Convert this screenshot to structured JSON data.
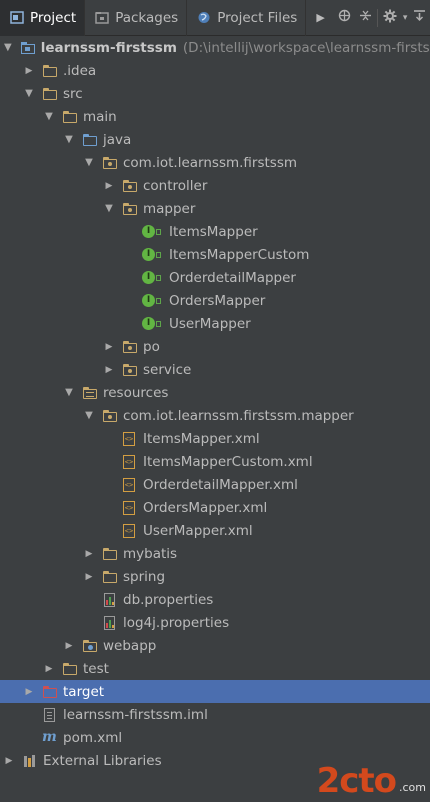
{
  "toolbar": {
    "tabs": [
      {
        "label": "Project",
        "icon": "project-icon"
      },
      {
        "label": "Packages",
        "icon": "packages-icon"
      },
      {
        "label": "Project Files",
        "icon": "project-files-icon"
      }
    ],
    "more_icon": "chevron-right-icon",
    "actions": [
      "globe-settings-icon",
      "collapse-icon",
      "gear-icon",
      "hide-icon"
    ]
  },
  "tree": [
    {
      "label": "learnssm-firstssm",
      "path": "(D:\\intellij\\workspace\\learnssm-firstssm",
      "depth": 0,
      "arrow": "down",
      "icon": "module-icon",
      "bold": true
    },
    {
      "label": ".idea",
      "depth": 1,
      "arrow": "right",
      "icon": "folder-icon"
    },
    {
      "label": "src",
      "depth": 1,
      "arrow": "down",
      "icon": "folder-icon"
    },
    {
      "label": "main",
      "depth": 2,
      "arrow": "down",
      "icon": "folder-icon"
    },
    {
      "label": "java",
      "depth": 3,
      "arrow": "down",
      "icon": "source-folder-icon"
    },
    {
      "label": "com.iot.learnssm.firstssm",
      "depth": 4,
      "arrow": "down",
      "icon": "package-icon"
    },
    {
      "label": "controller",
      "depth": 5,
      "arrow": "right",
      "icon": "package-icon"
    },
    {
      "label": "mapper",
      "depth": 5,
      "arrow": "down",
      "icon": "package-icon"
    },
    {
      "label": "ItemsMapper",
      "depth": 6,
      "arrow": "none",
      "icon": "interface-icon"
    },
    {
      "label": "ItemsMapperCustom",
      "depth": 6,
      "arrow": "none",
      "icon": "interface-icon"
    },
    {
      "label": "OrderdetailMapper",
      "depth": 6,
      "arrow": "none",
      "icon": "interface-icon"
    },
    {
      "label": "OrdersMapper",
      "depth": 6,
      "arrow": "none",
      "icon": "interface-icon"
    },
    {
      "label": "UserMapper",
      "depth": 6,
      "arrow": "none",
      "icon": "interface-icon"
    },
    {
      "label": "po",
      "depth": 5,
      "arrow": "right",
      "icon": "package-icon"
    },
    {
      "label": "service",
      "depth": 5,
      "arrow": "right",
      "icon": "package-icon"
    },
    {
      "label": "resources",
      "depth": 3,
      "arrow": "down",
      "icon": "resources-folder-icon"
    },
    {
      "label": "com.iot.learnssm.firstssm.mapper",
      "depth": 4,
      "arrow": "down",
      "icon": "package-icon"
    },
    {
      "label": "ItemsMapper.xml",
      "depth": 5,
      "arrow": "none",
      "icon": "xml-file-icon"
    },
    {
      "label": "ItemsMapperCustom.xml",
      "depth": 5,
      "arrow": "none",
      "icon": "xml-file-icon"
    },
    {
      "label": "OrderdetailMapper.xml",
      "depth": 5,
      "arrow": "none",
      "icon": "xml-file-icon"
    },
    {
      "label": "OrdersMapper.xml",
      "depth": 5,
      "arrow": "none",
      "icon": "xml-file-icon"
    },
    {
      "label": "UserMapper.xml",
      "depth": 5,
      "arrow": "none",
      "icon": "xml-file-icon"
    },
    {
      "label": "mybatis",
      "depth": 4,
      "arrow": "right",
      "icon": "folder-icon"
    },
    {
      "label": "spring",
      "depth": 4,
      "arrow": "right",
      "icon": "folder-icon"
    },
    {
      "label": "db.properties",
      "depth": 4,
      "arrow": "none",
      "icon": "properties-file-icon"
    },
    {
      "label": "log4j.properties",
      "depth": 4,
      "arrow": "none",
      "icon": "properties-file-icon"
    },
    {
      "label": "webapp",
      "depth": 3,
      "arrow": "right",
      "icon": "web-folder-icon"
    },
    {
      "label": "test",
      "depth": 2,
      "arrow": "right",
      "icon": "folder-icon"
    },
    {
      "label": "target",
      "depth": 1,
      "arrow": "right",
      "icon": "excluded-folder-icon",
      "selected": true
    },
    {
      "label": "learnssm-firstssm.iml",
      "depth": 1,
      "arrow": "none",
      "icon": "iml-file-icon"
    },
    {
      "label": "pom.xml",
      "depth": 1,
      "arrow": "none",
      "icon": "maven-icon"
    },
    {
      "label": "External Libraries",
      "depth": 0,
      "arrow": "right",
      "icon": "libraries-icon"
    }
  ],
  "watermark": {
    "main": "2cto",
    "suffix": ".com"
  },
  "colors": {
    "background": "#3c3f41",
    "selection": "#4b6eaf",
    "interface": "#62b543",
    "folder": "#c8a96a",
    "source": "#6f9fd0",
    "excluded": "#d05050"
  }
}
